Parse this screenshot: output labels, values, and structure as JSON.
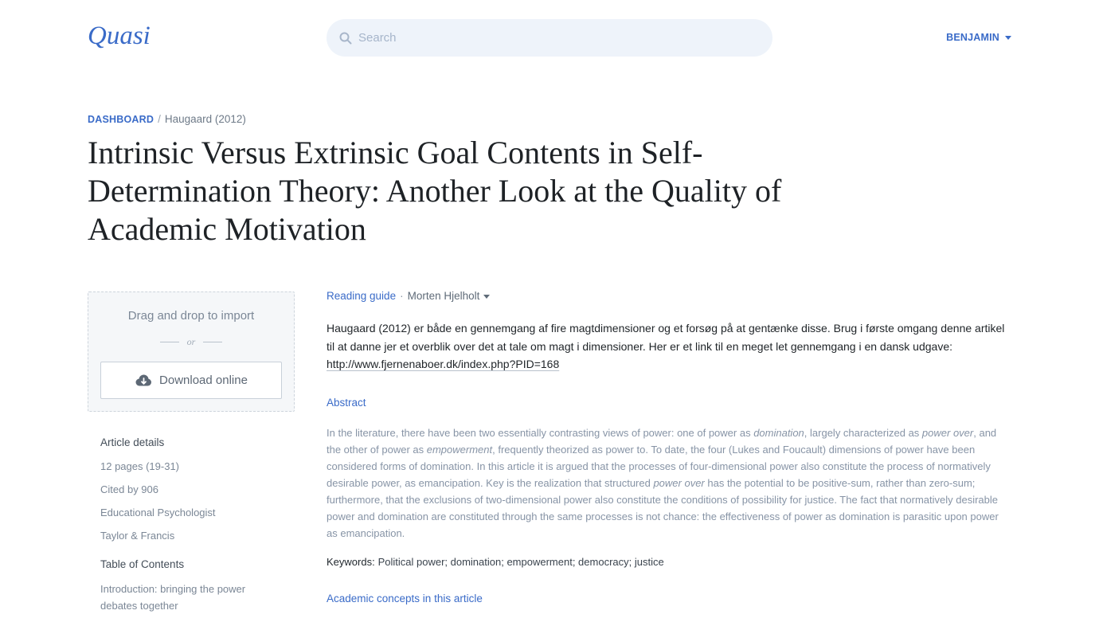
{
  "header": {
    "logo": "Quasi",
    "search": {
      "placeholder": "Search"
    },
    "user": {
      "name": "BENJAMIN"
    }
  },
  "breadcrumb": {
    "root": "DASHBOARD",
    "separator": "/",
    "current": "Haugaard (2012)"
  },
  "article": {
    "title": "Intrinsic Versus Extrinsic Goal Contents in Self-Determination Theory: Another Look at the Quality of Academic Motivation"
  },
  "import_box": {
    "drop_label": "Drag and drop to import",
    "divider_text": "or",
    "download_button": "Download online"
  },
  "article_details": {
    "heading": "Article details",
    "items": [
      "12 pages (19-31)",
      "Cited by 906",
      "Educational Psychologist",
      "Taylor & Francis"
    ]
  },
  "table_of_contents": {
    "heading": "Table of Contents",
    "items": [
      "Introduction: bringing the power debates together"
    ]
  },
  "reading_guide": {
    "label": "Reading guide",
    "separator": "·",
    "author": "Morten Hjelholt",
    "text": "Haugaard (2012) er både en gennemgang af fire magtdimensioner og et forsøg på at gentænke disse. Brug i første omgang denne artikel til at danne jer et overblik over det at tale om magt i dimensioner. Her er et link til en meget let gennemgang i en dansk udgave: ",
    "link": "http://www.fjernenaboer.dk/index.php?PID=168"
  },
  "abstract": {
    "heading": "Abstract",
    "segments": [
      {
        "text": "In the literature, there have been two essentially contrasting views of power: one of power as ",
        "italic": false
      },
      {
        "text": "domination",
        "italic": true
      },
      {
        "text": ", largely characterized as ",
        "italic": false
      },
      {
        "text": "power over",
        "italic": true
      },
      {
        "text": ", and the other of power as ",
        "italic": false
      },
      {
        "text": "empowerment",
        "italic": true
      },
      {
        "text": ", frequently theorized as power to. To date, the four (Lukes and Foucault) dimensions of power have been considered forms of domination. In this article it is argued that the processes of four-dimensional power also constitute the process of normatively desirable power, as emancipation. Key is the realization that structured ",
        "italic": false
      },
      {
        "text": "power over",
        "italic": true
      },
      {
        "text": " has the potential to be positive-sum, rather than zero-sum; furthermore, that the exclusions of two-dimensional power also constitute the conditions of possibility for justice. The fact that normatively desirable power and domination are constituted through the same processes is not chance: the effectiveness of power as domination is parasitic upon power as emancipation.",
        "italic": false
      }
    ]
  },
  "keywords": {
    "label": "Keywords:",
    "values": "Political power; domination; empowerment; democracy; justice"
  },
  "academic_concepts": {
    "heading": "Academic concepts in this article"
  },
  "icons": {
    "search": "search-icon",
    "user_menu": "chevron-down-icon",
    "author_menu": "chevron-down-icon",
    "download": "cloud-download-icon"
  },
  "colors": {
    "accent": "#3a6bc8",
    "text": "#1f2428",
    "muted": "#7b8796",
    "abstract_text": "#8794a6",
    "search_background": "#eef3fa",
    "border": "#c8d0d9"
  }
}
